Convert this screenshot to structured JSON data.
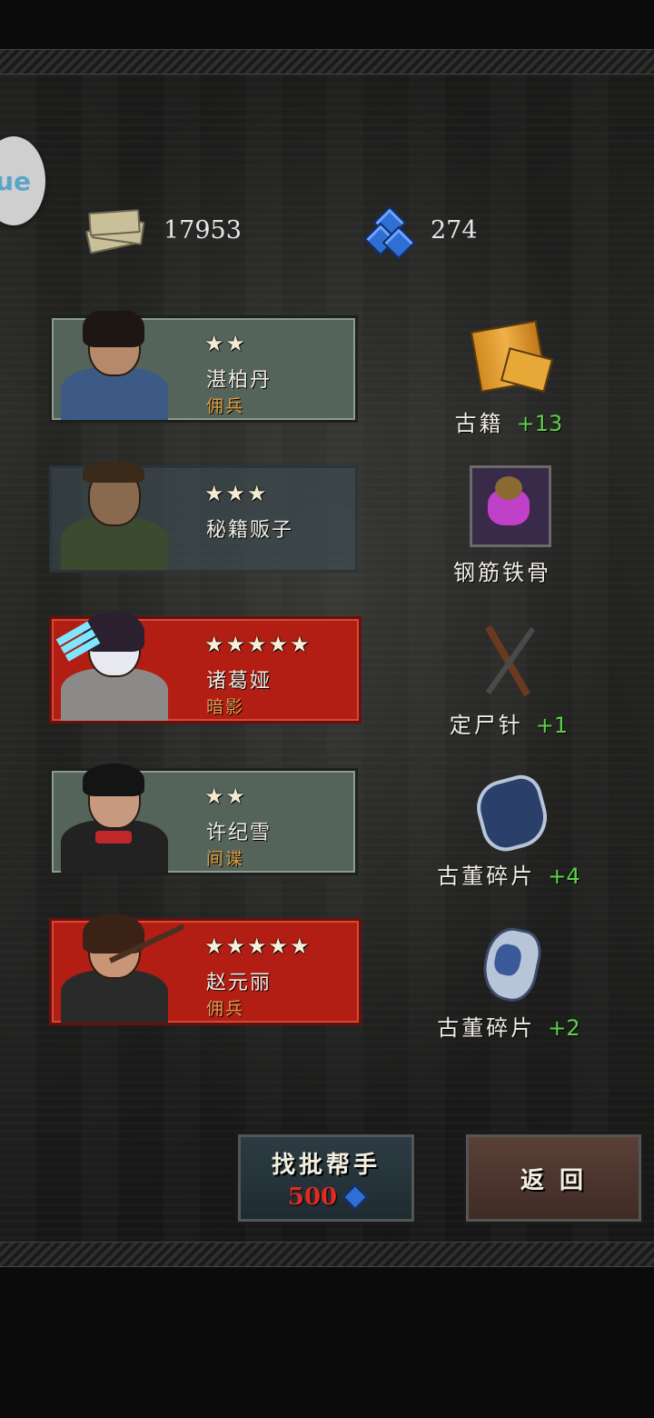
{
  "currency": {
    "cash": {
      "icon": "cash-stack-icon",
      "value": "17953"
    },
    "gems": {
      "icon": "blue-gem-icon",
      "value": "274"
    }
  },
  "float_button": {
    "text": "ue"
  },
  "recruits": [
    {
      "stars": "★★",
      "name": "湛柏丹",
      "type": "佣兵",
      "style": "green"
    },
    {
      "stars": "★★★",
      "name": "秘籍贩子",
      "type": "",
      "style": "dark"
    },
    {
      "stars": "★★★★★",
      "name": "诸葛娅",
      "type": "暗影",
      "style": "red"
    },
    {
      "stars": "★★",
      "name": "许纪雪",
      "type": "间谍",
      "style": "green"
    },
    {
      "stars": "★★★★★",
      "name": "赵元丽",
      "type": "佣兵",
      "style": "red"
    }
  ],
  "rewards": [
    {
      "icon": "scroll-icon",
      "label": "古籍",
      "bonus": "+13"
    },
    {
      "icon": "skill-book-icon",
      "label": "钢筋铁骨",
      "bonus": ""
    },
    {
      "icon": "needles-icon",
      "label": "定尸针",
      "bonus": "+1"
    },
    {
      "icon": "porcelain-shard-icon",
      "label": "古董碎片",
      "bonus": "+4"
    },
    {
      "icon": "porcelain-shard-icon",
      "label": "古董碎片",
      "bonus": "+2"
    }
  ],
  "buttons": {
    "find_helper": {
      "label": "找批帮手",
      "cost": "500"
    },
    "back": {
      "label": "返 回"
    }
  },
  "colors": {
    "bonus_green": "#5fd04b",
    "rare_red": "#b21e14",
    "common_green": "#55645a",
    "type_orange": "#e0a040"
  }
}
